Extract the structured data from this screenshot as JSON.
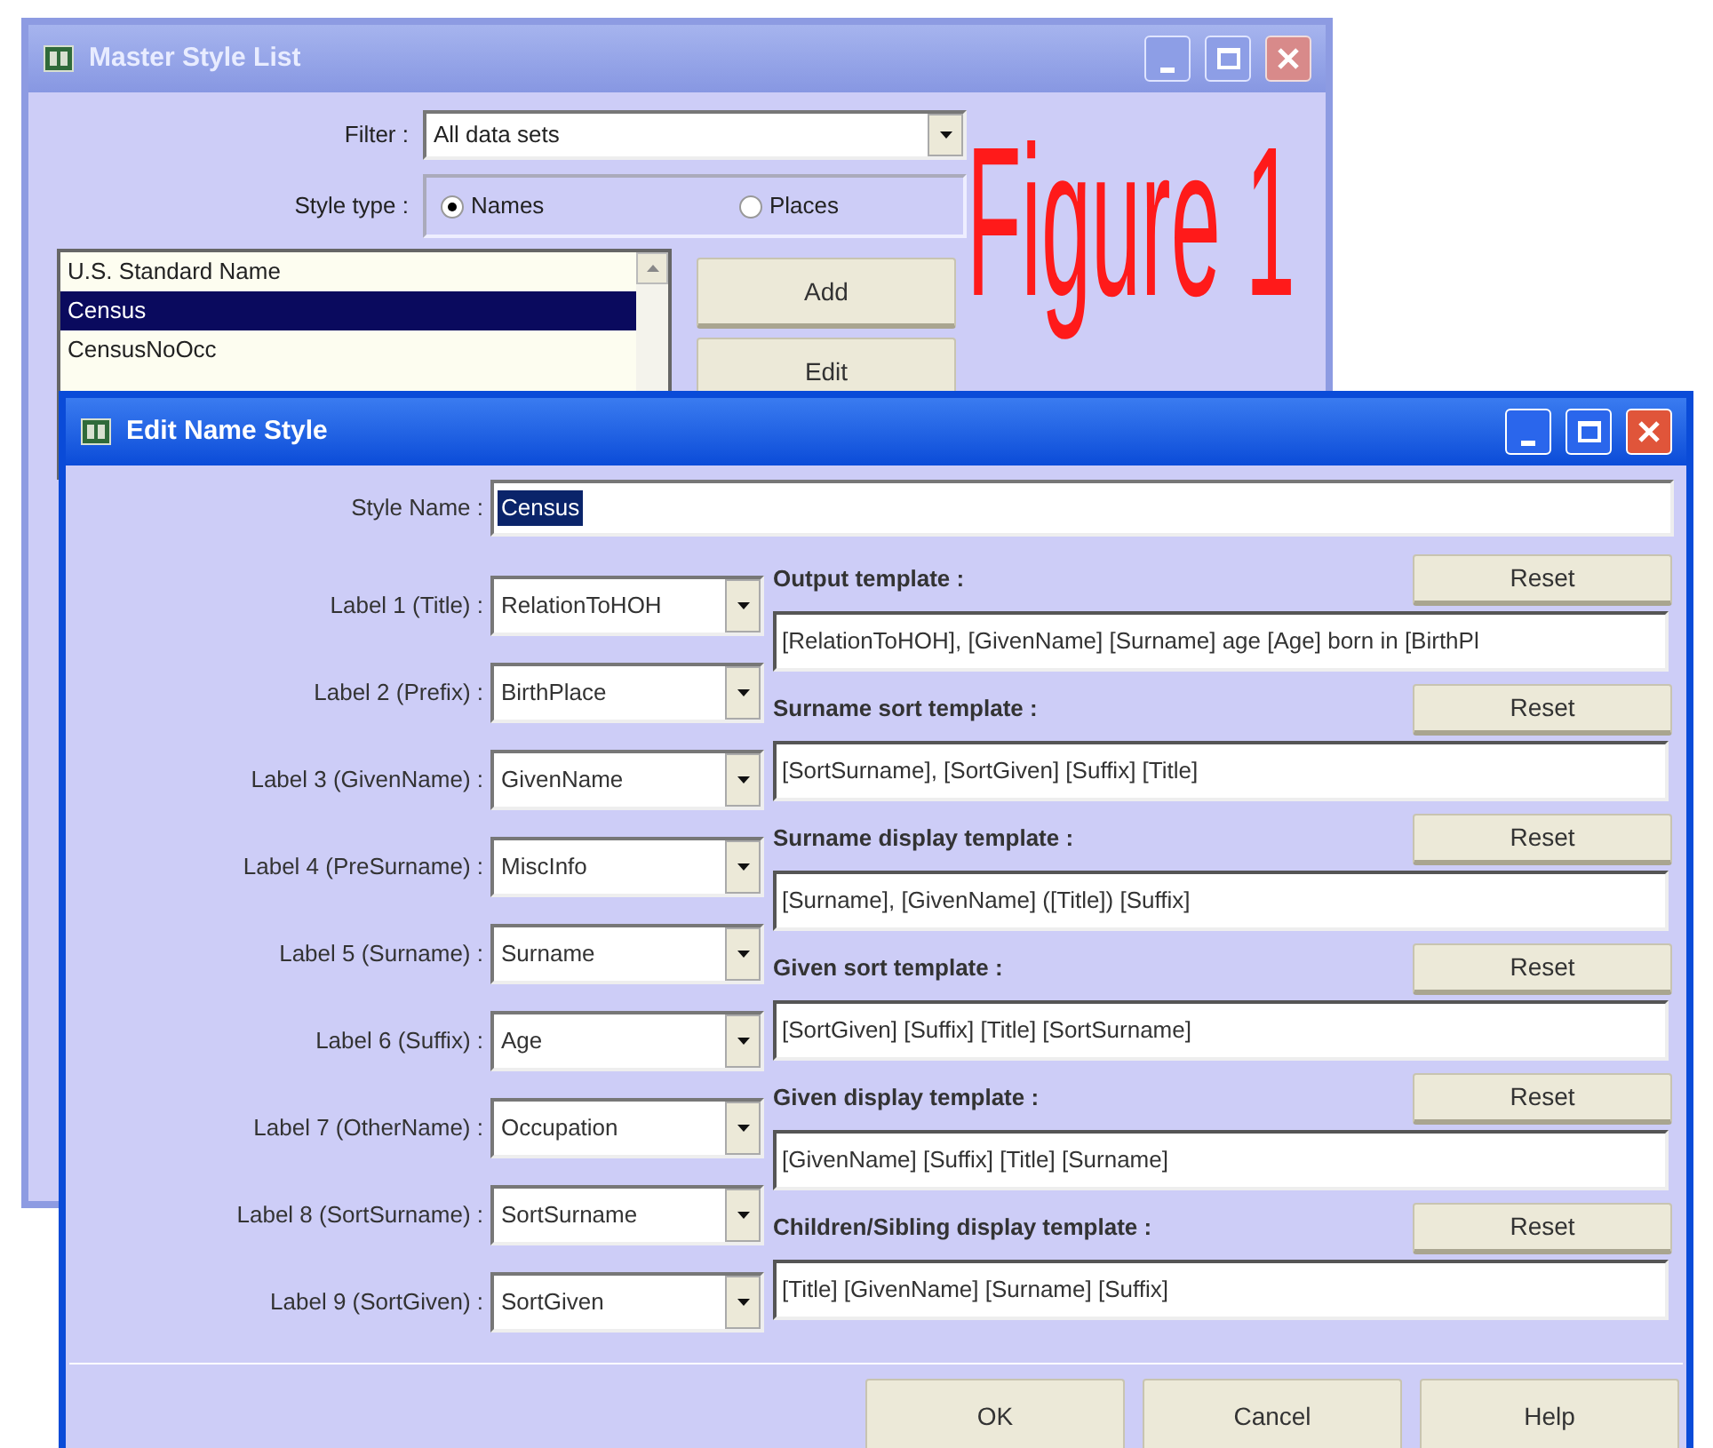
{
  "master_window": {
    "title": "Master Style List",
    "active": false,
    "filter": {
      "label": "Filter :",
      "value": "All data sets"
    },
    "style_type": {
      "label": "Style type :",
      "options": [
        {
          "label": "Names",
          "checked": true
        },
        {
          "label": "Places",
          "checked": false
        }
      ]
    },
    "styles": [
      {
        "label": "U.S. Standard Name",
        "selected": false
      },
      {
        "label": "Census",
        "selected": true
      },
      {
        "label": "CensusNoOcc",
        "selected": false
      }
    ],
    "buttons": [
      "Add",
      "Edit"
    ]
  },
  "figure_caption": "Figure 1",
  "edit_window": {
    "title": "Edit Name Style",
    "active": true,
    "style_name": {
      "label": "Style Name :",
      "value": "Census",
      "selected": true
    },
    "labels": [
      {
        "label": "Label 1 (Title) :",
        "value": "RelationToHOH"
      },
      {
        "label": "Label 2 (Prefix) :",
        "value": "BirthPlace"
      },
      {
        "label": "Label 3 (GivenName) :",
        "value": "GivenName"
      },
      {
        "label": "Label 4 (PreSurname) :",
        "value": "MiscInfo"
      },
      {
        "label": "Label 5 (Surname) :",
        "value": "Surname"
      },
      {
        "label": "Label 6 (Suffix) :",
        "value": "Age"
      },
      {
        "label": "Label 7 (OtherName) :",
        "value": "Occupation"
      },
      {
        "label": "Label 8 (SortSurname) :",
        "value": "SortSurname"
      },
      {
        "label": "Label 9 (SortGiven) :",
        "value": "SortGiven"
      }
    ],
    "templates": [
      {
        "label": "Output template :",
        "value": "[RelationToHOH], [GivenName] [Surname] age [Age] born in [BirthPl",
        "reset": "Reset"
      },
      {
        "label": "Surname sort template :",
        "value": "[SortSurname], [SortGiven] [Suffix] [Title]",
        "reset": "Reset"
      },
      {
        "label": "Surname display template :",
        "value": "[Surname], [GivenName] ([Title]) [Suffix]",
        "reset": "Reset"
      },
      {
        "label": "Given sort template :",
        "value": "[SortGiven] [Suffix] [Title] [SortSurname]",
        "reset": "Reset"
      },
      {
        "label": "Given display template :",
        "value": "[GivenName] [Suffix] [Title] [Surname]",
        "reset": "Reset"
      },
      {
        "label": "Children/Sibling display template :",
        "value": "[Title] [GivenName] [Surname] [Suffix]",
        "reset": "Reset"
      }
    ],
    "buttons": [
      "OK",
      "Cancel",
      "Help"
    ]
  }
}
